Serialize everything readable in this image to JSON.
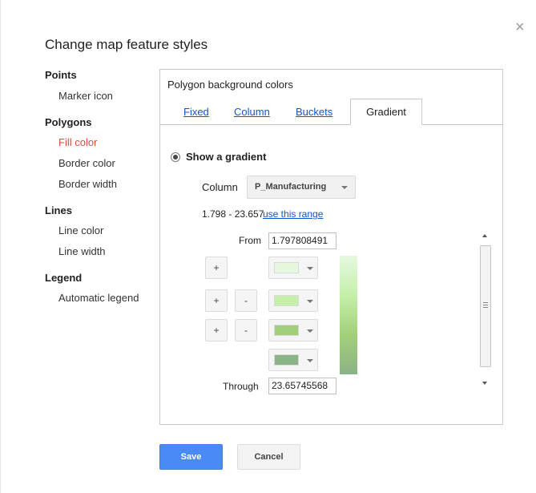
{
  "dialog": {
    "title": "Change map feature styles",
    "close_glyph": "×"
  },
  "nav": {
    "sections": [
      {
        "label": "Points",
        "items": [
          {
            "label": "Marker icon",
            "active": false
          }
        ]
      },
      {
        "label": "Polygons",
        "items": [
          {
            "label": "Fill color",
            "active": true
          },
          {
            "label": "Border color",
            "active": false
          },
          {
            "label": "Border width",
            "active": false
          }
        ]
      },
      {
        "label": "Lines",
        "items": [
          {
            "label": "Line color",
            "active": false
          },
          {
            "label": "Line width",
            "active": false
          }
        ]
      },
      {
        "label": "Legend",
        "items": [
          {
            "label": "Automatic legend",
            "active": false
          }
        ]
      }
    ]
  },
  "panel": {
    "header": "Polygon background colors",
    "tabs": [
      {
        "label": "Fixed",
        "selected": false
      },
      {
        "label": "Column",
        "selected": false
      },
      {
        "label": "Buckets",
        "selected": false
      },
      {
        "label": "Gradient",
        "selected": true
      }
    ],
    "gradient": {
      "option_label": "Show a gradient",
      "option_checked": true,
      "column_label": "Column",
      "column_value": "P_Manufacturing",
      "range_text": "1.798 - 23.657",
      "range_link": "use this range",
      "from_label": "From",
      "from_value": "1.797808491",
      "through_label": "Through",
      "through_value": "23.65745568",
      "add_label": "+",
      "remove_label": "-",
      "colors": [
        "#e6f8e0",
        "#c5f0a9",
        "#a2d07a",
        "#8ab486"
      ]
    }
  },
  "footer": {
    "save_label": "Save",
    "cancel_label": "Cancel"
  },
  "colors": {
    "accent": "#4a8af4",
    "link": "#1155cc",
    "active_nav": "#dd4b39"
  }
}
